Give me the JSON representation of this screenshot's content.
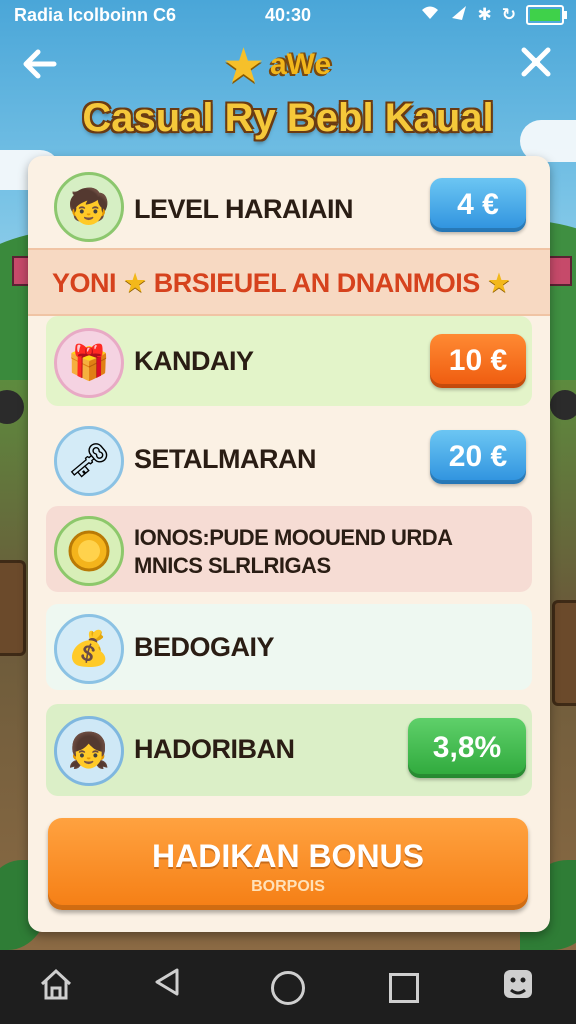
{
  "status_bar": {
    "carrier": "Radia Icolboinn C6",
    "time": "40:30",
    "icons": [
      "wifi-icon",
      "signal-icon",
      "bluetooth-icon",
      "battery-icon"
    ],
    "battery_level": 0.92
  },
  "header": {
    "logo_text": "aWe",
    "title": "Casual Ry Bebl Kaual"
  },
  "panel": {
    "level": {
      "label": "LEVEL HARAIAIN",
      "price": "4 €"
    },
    "banner": {
      "part1": "YONI",
      "part2": "BRSIEUEL AN DNANMOIS"
    },
    "items": [
      {
        "label": "KANDAIY",
        "price": "10 €"
      },
      {
        "label": "SETALMARAN",
        "price": "20 €"
      }
    ],
    "bonus_info": {
      "line1": "IONOS:PUDE MOOUEND URDA",
      "line2": "MNICS SLRLRIGAS"
    },
    "bedogaiy": {
      "label": "BEDOGAIY"
    },
    "hadoriban": {
      "label": "HADORIBAN",
      "value": "3,8%"
    },
    "cta": {
      "label": "HADIKAN BONUS",
      "sublabel": "BORPOIS"
    }
  },
  "colors": {
    "blue_price": "#2d91de",
    "orange_price": "#ee5a0e",
    "green_value": "#2ea83b",
    "cta_orange": "#f57e14",
    "title_gold": "#f5c83a"
  }
}
